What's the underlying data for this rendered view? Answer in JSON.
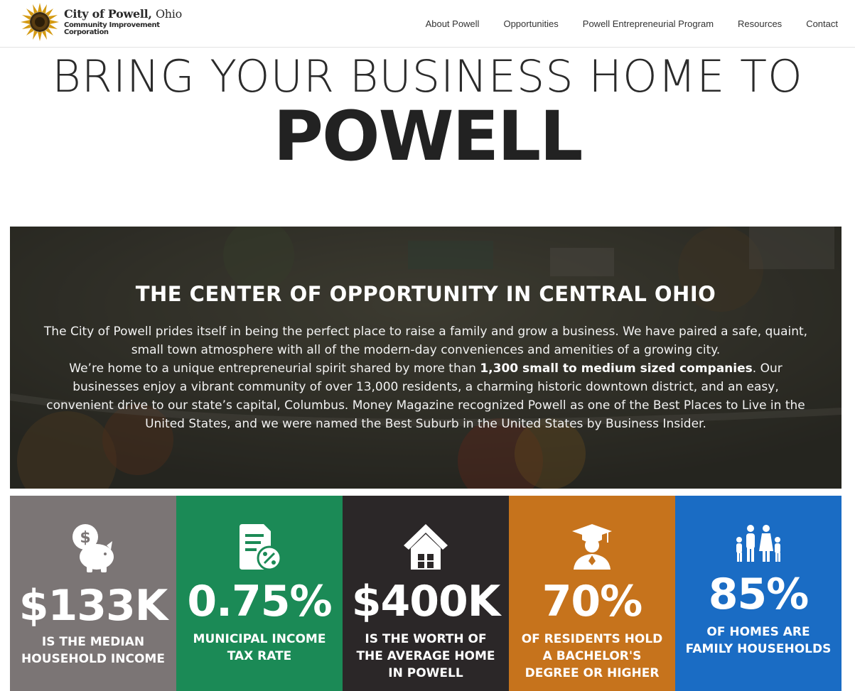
{
  "header": {
    "logo": {
      "line1_bold": "City of Powell,",
      "line1_light": "Ohio",
      "line2": "Community Improvement Corporation",
      "icon": "sun-logo-icon"
    },
    "nav": [
      {
        "label": "About Powell"
      },
      {
        "label": "Opportunities"
      },
      {
        "label": "Powell Entrepreneurial Program"
      },
      {
        "label": "Resources"
      },
      {
        "label": "Contact"
      }
    ]
  },
  "hero": {
    "line1": "BRING YOUR BUSINESS HOME TO",
    "line2": "POWELL"
  },
  "banner": {
    "heading": {
      "part1": "THE ",
      "part2": "CENTER",
      "part3": " OF OPPORTUNITY IN ",
      "part4": "CENTRAL",
      "part5": " OHIO"
    },
    "para1": "The City of Powell prides itself in being the perfect place to raise a family and grow a business. We have paired a safe, quaint, small town atmosphere with all of the modern-day conveniences and amenities of a growing city.",
    "para2_start": "We’re home to a unique entrepreneurial spirit shared by more than ",
    "para2_bold": "1,300 small to medium sized companies",
    "para2_end": ". Our businesses enjoy a vibrant community of over 13,000 residents, a charming historic downtown district, and an easy, convenient drive to our state’s capital, Columbus. Money Magazine recognized Powell as one of the Best Places to Live in the United States, and we were named the Best Suburb in the United States by Business Insider."
  },
  "stats": [
    {
      "value": "$133K",
      "desc": "IS THE MEDIAN HOUSEHOLD INCOME",
      "color": "#7b7575",
      "icon": "piggy-bank-icon"
    },
    {
      "value": "0.75%",
      "desc": "MUNICIPAL INCOME TAX RATE",
      "color": "#1b8a56",
      "icon": "tax-document-icon"
    },
    {
      "value": "$400K",
      "desc": "IS THE WORTH OF THE AVERAGE HOME IN POWELL",
      "color": "#2b2728",
      "icon": "house-icon"
    },
    {
      "value": "70%",
      "desc": "OF RESIDENTS HOLD A BACHELOR'S DEGREE OR HIGHER",
      "color": "#c6731c",
      "icon": "graduate-icon"
    },
    {
      "value": "85%",
      "desc": "OF HOMES ARE FAMILY HOUSEHOLDS",
      "color": "#1a6cc4",
      "icon": "family-icon"
    }
  ]
}
